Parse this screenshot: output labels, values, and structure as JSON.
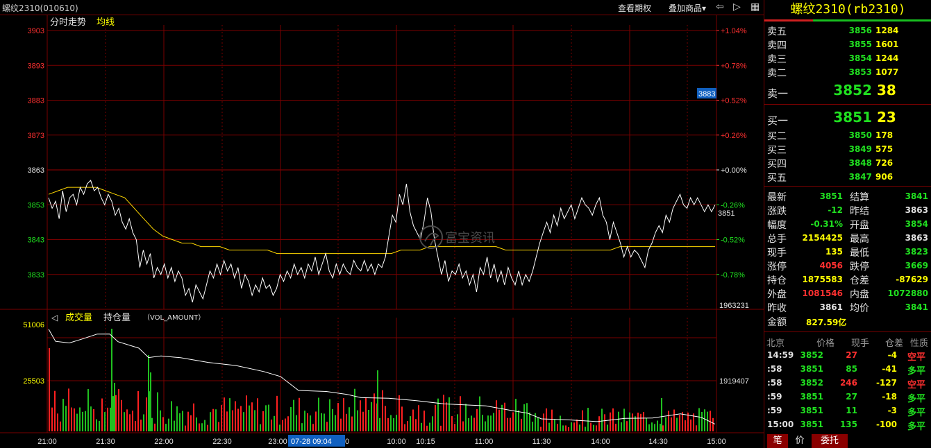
{
  "topbar": {
    "symbol": "螺纹2310(010610)",
    "btn_period": "查看期权",
    "btn_overlay": "叠加商品▾",
    "icon_prev": "◁",
    "icon_next": "▷",
    "icon_return": "⇦",
    "icon_layout": "▦"
  },
  "main_chart": {
    "title1": "分时走势",
    "title2": "均线",
    "price_labels": [
      "3903",
      "3893",
      "3883",
      "3873",
      "3863",
      "3853",
      "3843",
      "3833"
    ],
    "pct_labels": [
      "+1.04%",
      "+0.78%",
      "+0.52%",
      "+0.26%",
      "+0.00%",
      "-0.26%",
      "-0.52%",
      "-0.78%"
    ],
    "cursor_price_tag": "3883",
    "last_price_tag": "3851",
    "watermark": "富宝资讯"
  },
  "volume_chart": {
    "title_vol": "成交量",
    "title_oi": "持仓量",
    "title_formula": "（VOL_AMOUNT）",
    "vol_labels": [
      "51006",
      "25503"
    ],
    "oi_labels": [
      "1963231",
      "1919407"
    ]
  },
  "time_axis": {
    "labels": [
      "21:00",
      "21:30",
      "22:00",
      "22:30",
      "23:00",
      "10:00",
      "10:15",
      "11:00",
      "11:30",
      "14:00",
      "14:30",
      "15:00"
    ],
    "cursor_date": "07-28 09:04",
    "cursor_tail": "0"
  },
  "colors": {
    "up": "#ff3030",
    "down": "#20e020",
    "grid": "#7a0000",
    "price_line": "#ffffff",
    "avg_line": "#ffd700",
    "volume_up": "#ff2020",
    "volume_down": "#20c020",
    "title_yellow": "#ffff00"
  },
  "contract": {
    "title": "螺纹2310(rb2310)"
  },
  "orderbook": {
    "asks": [
      {
        "label": "卖五",
        "price": "3856",
        "vol": "1284"
      },
      {
        "label": "卖四",
        "price": "3855",
        "vol": "1601"
      },
      {
        "label": "卖三",
        "price": "3854",
        "vol": "1244"
      },
      {
        "label": "卖二",
        "price": "3853",
        "vol": "1077"
      },
      {
        "label": "卖一",
        "price": "3852",
        "vol": "38"
      }
    ],
    "bids": [
      {
        "label": "买一",
        "price": "3851",
        "vol": "23"
      },
      {
        "label": "买二",
        "price": "3850",
        "vol": "178"
      },
      {
        "label": "买三",
        "price": "3849",
        "vol": "575"
      },
      {
        "label": "买四",
        "price": "3848",
        "vol": "726"
      },
      {
        "label": "买五",
        "price": "3847",
        "vol": "906"
      }
    ]
  },
  "stats": [
    {
      "l1": "最新",
      "v1": "3851",
      "c1": "#20e020",
      "l2": "结算",
      "v2": "3841",
      "c2": "#20e020"
    },
    {
      "l1": "涨跌",
      "v1": "-12",
      "c1": "#20e020",
      "l2": "昨结",
      "v2": "3863",
      "c2": "#e0e0e0"
    },
    {
      "l1": "幅度",
      "v1": "-0.31%",
      "c1": "#20e020",
      "l2": "开盘",
      "v2": "3854",
      "c2": "#20e020"
    },
    {
      "l1": "总手",
      "v1": "2154425",
      "c1": "#ffff00",
      "l2": "最高",
      "v2": "3863",
      "c2": "#e0e0e0"
    },
    {
      "l1": "现手",
      "v1": "135",
      "c1": "#ffff00",
      "l2": "最低",
      "v2": "3823",
      "c2": "#20e020"
    },
    {
      "l1": "涨停",
      "v1": "4056",
      "c1": "#ff3030",
      "l2": "跌停",
      "v2": "3669",
      "c2": "#20e020"
    },
    {
      "l1": "持仓",
      "v1": "1875583",
      "c1": "#ffff00",
      "l2": "仓差",
      "v2": "-87629",
      "c2": "#ffff00"
    },
    {
      "l1": "外盘",
      "v1": "1081546",
      "c1": "#ff3030",
      "l2": "内盘",
      "v2": "1072880",
      "c2": "#20e020"
    },
    {
      "l1": "昨收",
      "v1": "3861",
      "c1": "#e0e0e0",
      "l2": "均价",
      "v2": "3841",
      "c2": "#20e020"
    },
    {
      "l1": "金额",
      "v1": "827.59亿",
      "c1": "#ffff00",
      "l2": "",
      "v2": "",
      "c2": "#e0e0e0"
    }
  ],
  "trades_header": {
    "time": "北京",
    "price": "价格",
    "vol": "现手",
    "oi": "仓差",
    "nature": "性质"
  },
  "trades": [
    {
      "time": "14:59",
      "price": "3852",
      "pc": "#20e020",
      "vol": "27",
      "vc": "#ff3030",
      "oi": "-4",
      "nature": "空平",
      "nc": "#ff3030"
    },
    {
      "time": ":58",
      "price": "3851",
      "pc": "#20e020",
      "vol": "85",
      "vc": "#20e020",
      "oi": "-41",
      "nature": "多平",
      "nc": "#20e020"
    },
    {
      "time": ":58",
      "price": "3852",
      "pc": "#20e020",
      "vol": "246",
      "vc": "#ff3030",
      "oi": "-127",
      "nature": "空平",
      "nc": "#ff3030"
    },
    {
      "time": ":59",
      "price": "3851",
      "pc": "#20e020",
      "vol": "27",
      "vc": "#20e020",
      "oi": "-18",
      "nature": "多平",
      "nc": "#20e020"
    },
    {
      "time": ":59",
      "price": "3851",
      "pc": "#20e020",
      "vol": "11",
      "vc": "#20e020",
      "oi": "-3",
      "nature": "多平",
      "nc": "#20e020"
    },
    {
      "time": "15:00",
      "price": "3851",
      "pc": "#20e020",
      "vol": "135",
      "vc": "#20e020",
      "oi": "-100",
      "nature": "多平",
      "nc": "#20e020"
    }
  ],
  "bottom_tabs": [
    "笔",
    "价",
    "委托"
  ],
  "chart_data": {
    "type": "line",
    "ylim": [
      3823,
      3903
    ],
    "prev_settle": 3863,
    "price": [
      3855,
      3852,
      3854,
      3849,
      3857,
      3851,
      3855,
      3856,
      3853,
      3858,
      3856,
      3859,
      3860,
      3857,
      3858,
      3855,
      3853,
      3856,
      3854,
      3850,
      3852,
      3848,
      3846,
      3849,
      3845,
      3843,
      3835,
      3840,
      3836,
      3839,
      3832,
      3835,
      3833,
      3836,
      3832,
      3835,
      3831,
      3834,
      3832,
      3827,
      3829,
      3825,
      3830,
      3828,
      3826,
      3830,
      3834,
      3832,
      3836,
      3833,
      3837,
      3834,
      3836,
      3832,
      3835,
      3829,
      3833,
      3831,
      3827,
      3830,
      3828,
      3832,
      3829,
      3830,
      3827,
      3829,
      3833,
      3831,
      3834,
      3832,
      3836,
      3833,
      3835,
      3832,
      3836,
      3834,
      3838,
      3833,
      3836,
      3839,
      3834,
      3832,
      3836,
      3833,
      3836,
      3834,
      3833,
      3837,
      3835,
      3834,
      3837,
      3834,
      3836,
      3833,
      3836,
      3835,
      3838,
      3844,
      3850,
      3848,
      3856,
      3853,
      3859,
      3851,
      3847,
      3845,
      3843,
      3848,
      3855,
      3851,
      3843,
      3838,
      3833,
      3837,
      3831,
      3834,
      3833,
      3836,
      3832,
      3834,
      3830,
      3833,
      3828,
      3835,
      3833,
      3838,
      3832,
      3836,
      3831,
      3834,
      3830,
      3835,
      3832,
      3830,
      3834,
      3830,
      3833,
      3831,
      3834,
      3838,
      3842,
      3845,
      3848,
      3845,
      3850,
      3847,
      3852,
      3849,
      3851,
      3853,
      3849,
      3852,
      3855,
      3853,
      3852,
      3850,
      3853,
      3855,
      3850,
      3848,
      3843,
      3848,
      3845,
      3842,
      3838,
      3841,
      3838,
      3840,
      3839,
      3837,
      3835,
      3840,
      3842,
      3845,
      3847,
      3845,
      3850,
      3848,
      3852,
      3854,
      3856,
      3853,
      3852,
      3855,
      3853,
      3855,
      3853,
      3851,
      3853,
      3851,
      3853
    ],
    "avg": [
      3856,
      3857,
      3858,
      3858,
      3858,
      3858,
      3857,
      3856,
      3855,
      3852,
      3849,
      3846,
      3844,
      3843,
      3842,
      3842,
      3841,
      3841,
      3841,
      3840,
      3840,
      3840,
      3840,
      3840,
      3839,
      3839,
      3839,
      3839,
      3839,
      3839,
      3839,
      3839,
      3839,
      3839,
      3839,
      3839,
      3839,
      3840,
      3840,
      3840,
      3841,
      3841,
      3841,
      3841,
      3841,
      3841,
      3841,
      3841,
      3840,
      3840,
      3840,
      3840,
      3840,
      3840,
      3840,
      3840,
      3840,
      3840,
      3840,
      3840,
      3841,
      3841,
      3841,
      3841,
      3841,
      3841,
      3841,
      3841,
      3841,
      3841,
      3841
    ],
    "volume_max": 51006,
    "oi_range": [
      1875583,
      1963231
    ]
  }
}
